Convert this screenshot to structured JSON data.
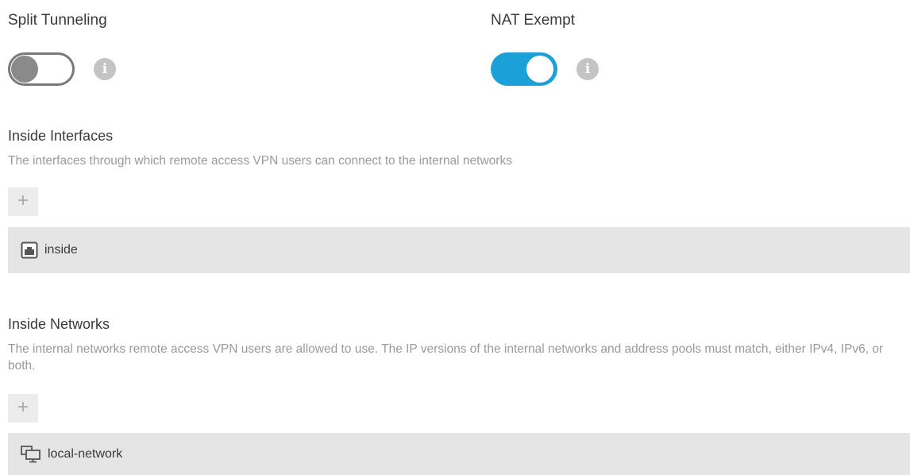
{
  "split_tunneling": {
    "label": "Split Tunneling",
    "state": "off",
    "info_icon": "info-icon"
  },
  "nat_exempt": {
    "label": "NAT Exempt",
    "state": "on",
    "info_icon": "info-icon"
  },
  "inside_interfaces": {
    "title": "Inside Interfaces",
    "description": "The interfaces through which remote access VPN users can connect to the internal networks",
    "add_label": "+",
    "items": [
      {
        "label": "inside",
        "icon": "interface-icon"
      }
    ]
  },
  "inside_networks": {
    "title": "Inside Networks",
    "description": "The internal networks remote access VPN users are allowed to use. The IP versions of the internal networks and address pools must match, either IPv4, IPv6, or both.",
    "add_label": "+",
    "items": [
      {
        "label": "local-network",
        "icon": "network-object-icon"
      }
    ]
  },
  "colors": {
    "toggle_on": "#1ba0d7",
    "toggle_off": "#7a7a7a",
    "row_background": "#e5e5e5"
  }
}
